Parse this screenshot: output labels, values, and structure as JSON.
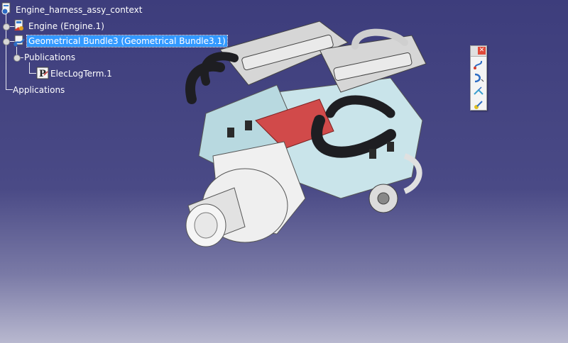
{
  "tree": {
    "root": {
      "label": "Engine_harness_assy_context",
      "icon": "product-icon"
    },
    "items": [
      {
        "label": "Engine (Engine.1)",
        "icon": "part-icon"
      },
      {
        "label": "Geometrical Bundle3 (Geometrical Bundle3.1)",
        "icon": "bundle-icon",
        "selected": true
      },
      {
        "label": "Publications",
        "icon": ""
      },
      {
        "label": "ElecLogTerm.1",
        "icon": "publication-icon"
      },
      {
        "label": "Applications",
        "icon": ""
      }
    ]
  },
  "toolbar": {
    "buttons": [
      "bundle-route-icon",
      "bundle-curve-icon",
      "bundle-branch-icon",
      "bundle-segment-icon"
    ]
  },
  "colors": {
    "background_top": "#3d3d7c",
    "background_bottom": "#b8b8cf",
    "selection": "#3399ff",
    "engine_body": "#c9e4ea",
    "engine_red": "#d14a4a",
    "hoses": "#1e1e22"
  }
}
